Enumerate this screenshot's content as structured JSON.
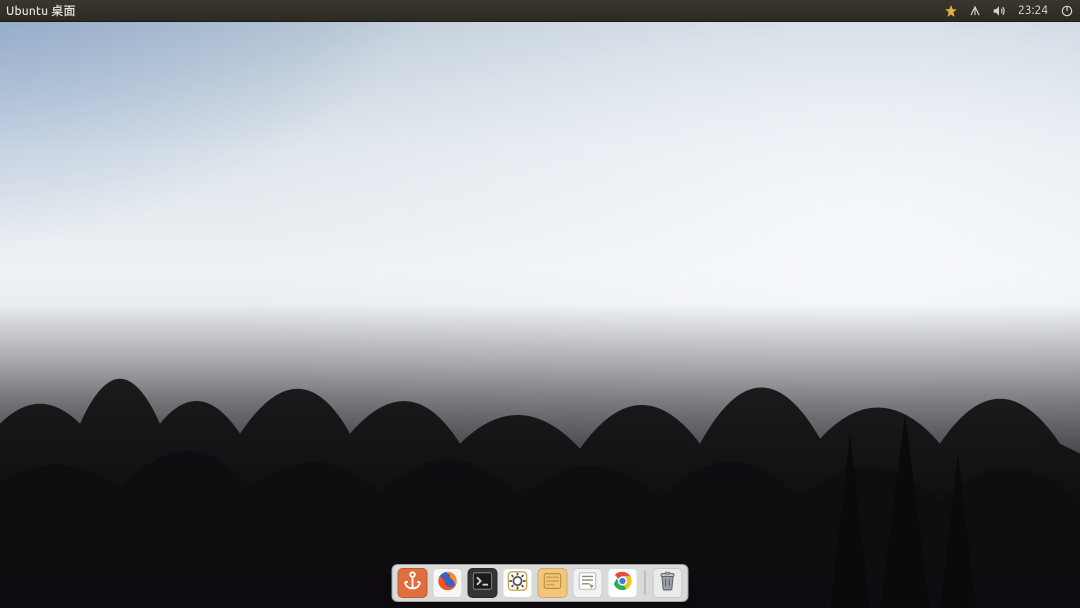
{
  "panel": {
    "title": "Ubuntu 桌面",
    "clock": "23:24",
    "tray_icons": [
      {
        "name": "notification-icon"
      },
      {
        "name": "network-icon"
      },
      {
        "name": "volume-icon"
      }
    ],
    "session_icon": "power-icon"
  },
  "dock": {
    "apps": [
      {
        "name": "anchor-app",
        "icon": "anchor-icon"
      },
      {
        "name": "firefox-app",
        "icon": "firefox-icon"
      },
      {
        "name": "terminal-app",
        "icon": "terminal-icon"
      },
      {
        "name": "settings-app",
        "icon": "gear-icon"
      },
      {
        "name": "files-app",
        "icon": "folder-icon"
      },
      {
        "name": "editor-app",
        "icon": "notebook-icon"
      },
      {
        "name": "chrome-app",
        "icon": "chrome-icon"
      }
    ],
    "trash": {
      "name": "trash",
      "icon": "trash-icon"
    }
  },
  "colors": {
    "panel_bg": "#2f2b25",
    "panel_fg": "#e8e5de",
    "dock_bg": "#ecececeb"
  }
}
